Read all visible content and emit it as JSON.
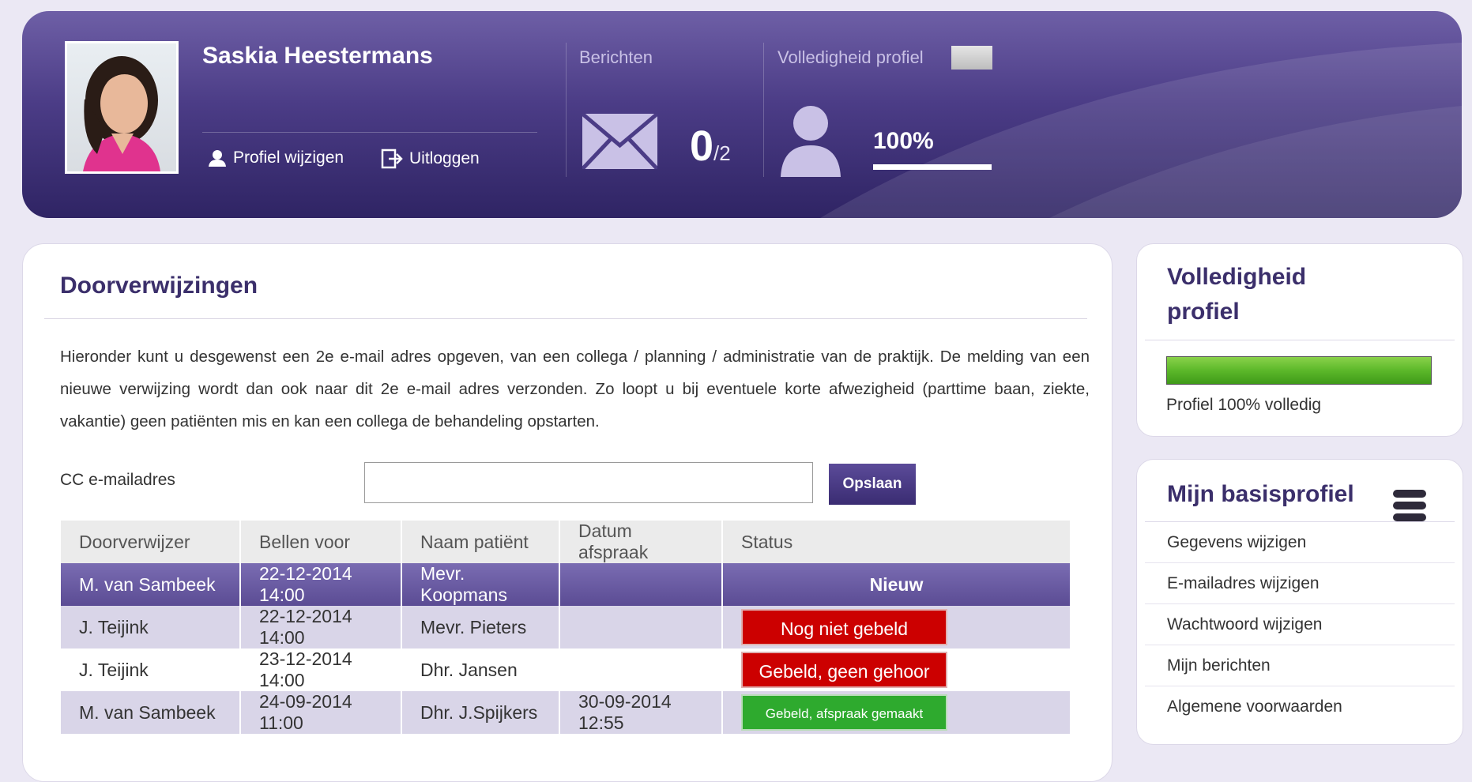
{
  "header": {
    "user_name": "Saskia Heestermans",
    "edit_profile_label": "Profiel wijzigen",
    "logout_label": "Uitloggen",
    "messages_label": "Berichten",
    "messages_count": "0",
    "messages_total": "/2",
    "completeness_label": "Volledigheid profiel",
    "completeness_value": "100%",
    "completeness_fraction": 1.0
  },
  "main": {
    "title": "Doorverwijzingen",
    "intro": "Hieronder kunt u desgewenst een 2e e-mail adres opgeven, van een collega / planning / administratie van de praktijk. De melding van een nieuwe verwijzing wordt dan ook naar dit 2e e-mail adres verzonden. Zo loopt u bij eventuele korte afwezigheid (parttime baan, ziekte, vakantie) geen patiënten mis en kan een collega de behandeling opstarten.",
    "cc_label": "CC e-mailadres",
    "cc_value": "",
    "save_label": "Opslaan",
    "table": {
      "headers": [
        "Doorverwijzer",
        "Bellen voor",
        "Naam patiënt",
        "Datum afspraak",
        "Status"
      ],
      "rows": [
        {
          "referrer": "M. van Sambeek",
          "call_before": "22-12-2014 14:00",
          "patient": "Mevr. Koopmans",
          "appointment": "",
          "status": "Nieuw"
        },
        {
          "referrer": "J. Teijink",
          "call_before": "22-12-2014 14:00",
          "patient": "Mevr. Pieters",
          "appointment": "",
          "status": "Nog niet gebeld"
        },
        {
          "referrer": "J. Teijink",
          "call_before": "23-12-2014 14:00",
          "patient": "Dhr. Jansen",
          "appointment": "",
          "status": "Gebeld, geen gehoor"
        },
        {
          "referrer": "M. van Sambeek",
          "call_before": "24-09-2014 11:00",
          "patient": "Dhr. J.Spijkers",
          "appointment": "30-09-2014 12:55",
          "status": "Gebeld, afspraak gemaakt"
        }
      ]
    }
  },
  "sidebar": {
    "completeness_title": "Volledigheid profiel",
    "completeness_text": "Profiel 100% volledig",
    "completeness_fraction": 1.0,
    "basis_title": "Mijn basisprofiel",
    "menu": [
      "Gegevens wijzigen",
      "E-mailadres wijzigen",
      "Wachtwoord wijzigen",
      "Mijn berichten",
      "Algemene voorwaarden"
    ]
  },
  "colors": {
    "header_primary": "#4b3c86",
    "accent_title": "#3b2f6b",
    "status_new": "#6b5ca6",
    "status_red": "#cc0000",
    "status_green": "#2eaa2e",
    "progress_green": "#5cb82a"
  }
}
